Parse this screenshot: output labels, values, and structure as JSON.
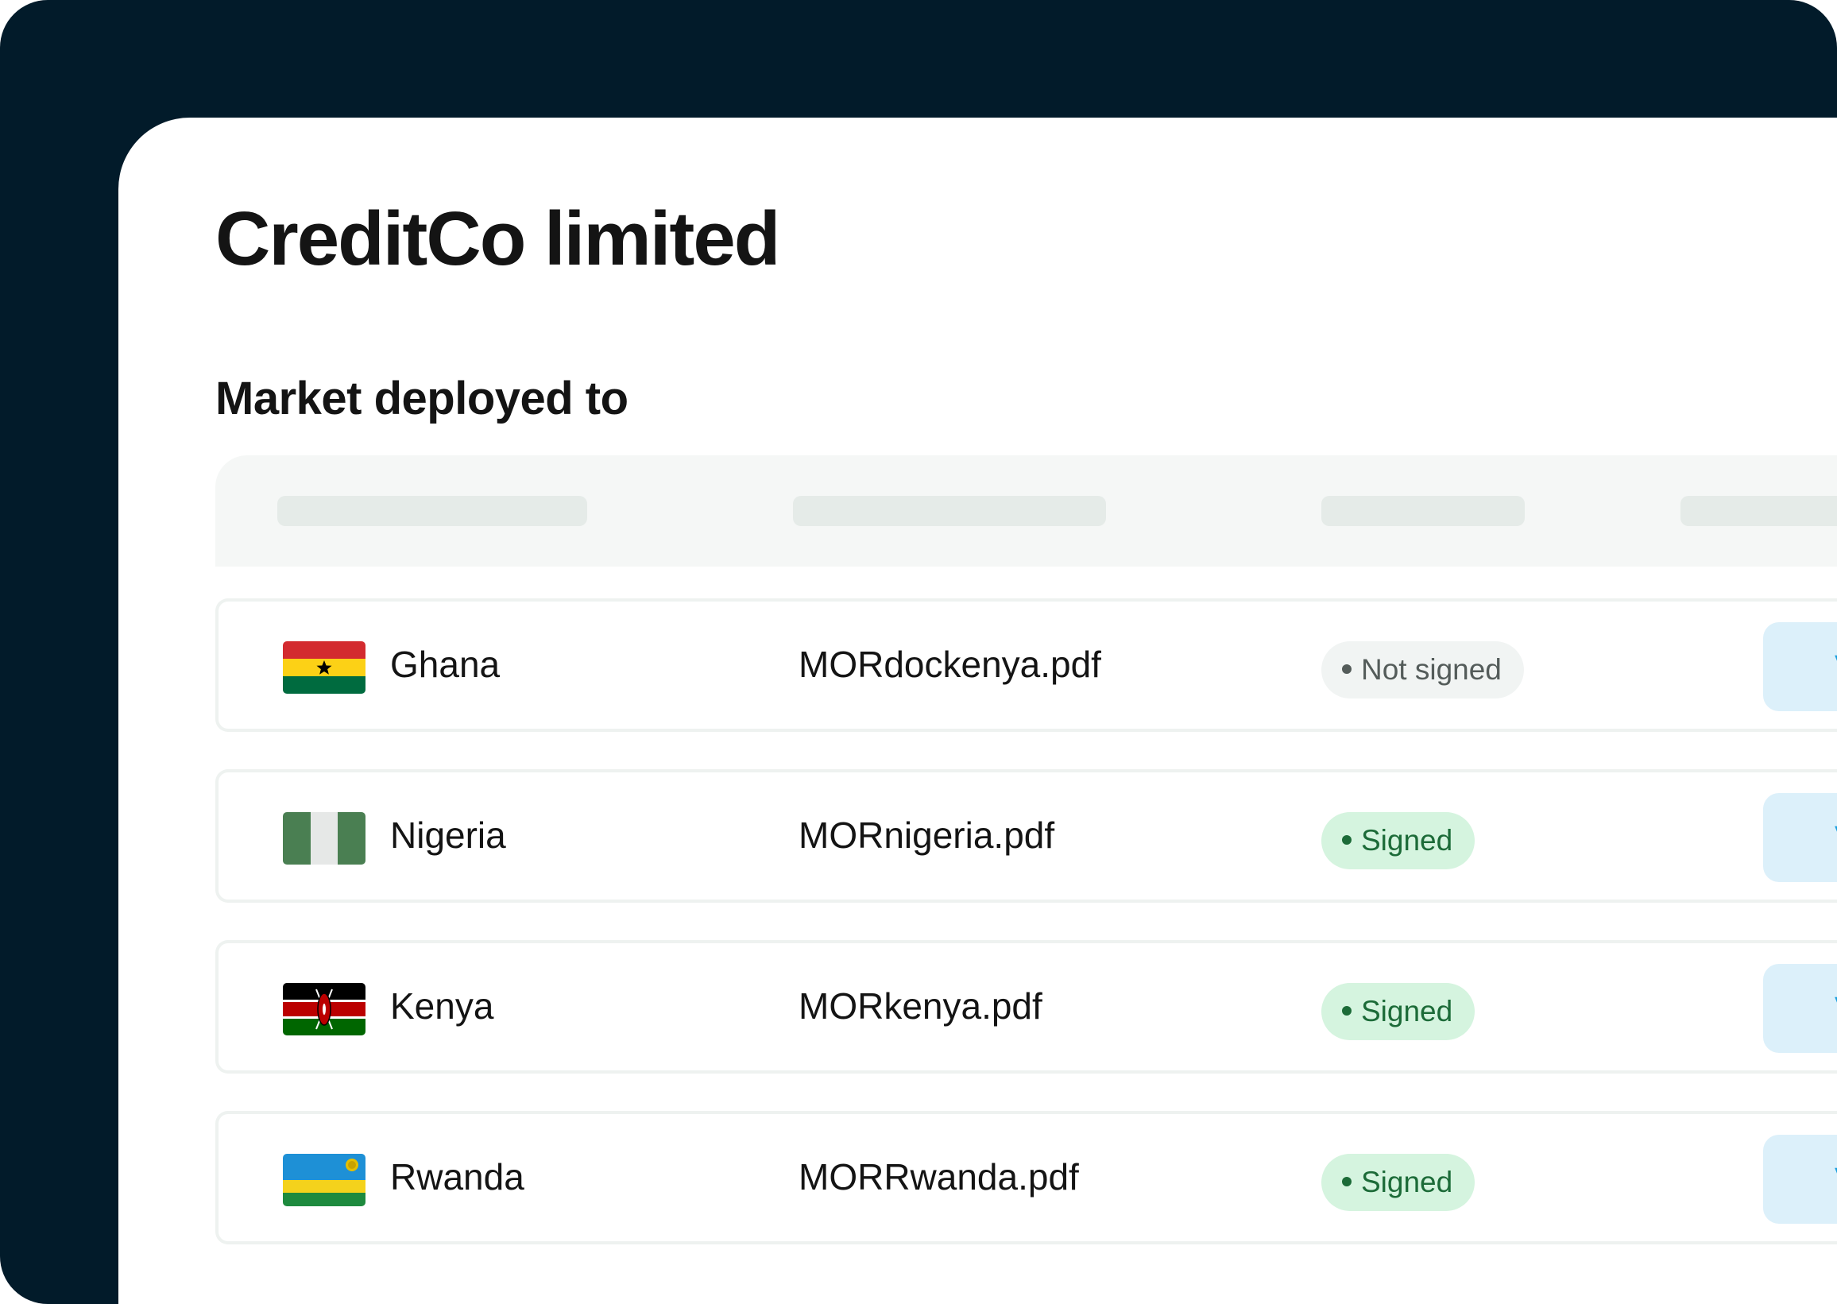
{
  "page": {
    "title": "CreditCo limited",
    "section_title": "Market deployed to"
  },
  "colors": {
    "frame_background": "#021b2a",
    "panel_background": "#ffffff",
    "signed_badge_bg": "#d5f4df",
    "signed_badge_text": "#1c6b38",
    "not_signed_badge_bg": "#f1f4f3",
    "not_signed_badge_text": "#545c5a",
    "view_button_bg": "#dcf0fa",
    "view_button_text": "#1a9fde"
  },
  "table": {
    "rows": [
      {
        "flag_icon": "ghana-flag-icon",
        "country": "Ghana",
        "file": "MORdockenya.pdf",
        "status": "Not signed",
        "action": "View"
      },
      {
        "flag_icon": "nigeria-flag-icon",
        "country": "Nigeria",
        "file": "MORnigeria.pdf",
        "status": "Signed",
        "action": "View"
      },
      {
        "flag_icon": "kenya-flag-icon",
        "country": "Kenya",
        "file": "MORkenya.pdf",
        "status": "Signed",
        "action": "View"
      },
      {
        "flag_icon": "rwanda-flag-icon",
        "country": "Rwanda",
        "file": "MORRwanda.pdf",
        "status": "Signed",
        "action": "View"
      }
    ]
  }
}
